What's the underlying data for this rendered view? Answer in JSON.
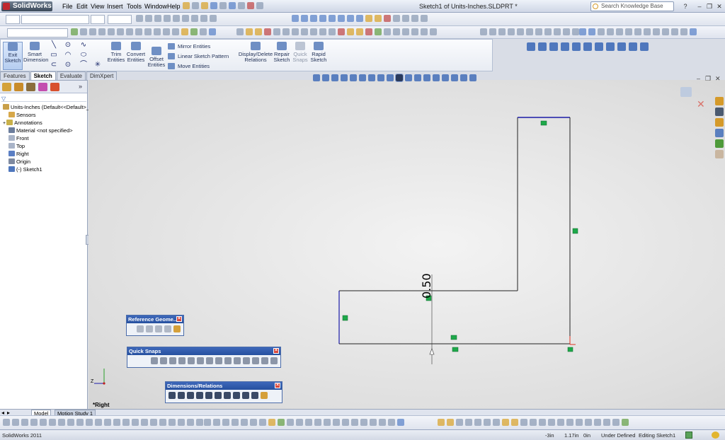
{
  "app": {
    "name": "SolidWorks",
    "document_title": "Sketch1 of Units-Inches.SLDPRT *"
  },
  "menu": [
    "File",
    "Edit",
    "View",
    "Insert",
    "Tools",
    "Window",
    "Help"
  ],
  "search": {
    "placeholder": "Search Knowledge Base"
  },
  "command_manager": {
    "exit_sketch": "Exit Sketch",
    "smart_dimension": "Smart Dimension",
    "trim_entities": "Trim Entities",
    "convert_entities": "Convert Entities",
    "offset_entities": "Offset Entities",
    "mirror_entities": "Mirror Entities",
    "linear_sketch_pattern": "Linear Sketch Pattern",
    "move_entities": "Move Entities",
    "display_delete_relations": "Display/Delete Relations",
    "repair_sketch": "Repair Sketch",
    "quick_snaps": "Quick Snaps",
    "rapid_sketch": "Rapid Sketch"
  },
  "tabs": [
    {
      "label": "Features",
      "active": false
    },
    {
      "label": "Sketch",
      "active": true
    },
    {
      "label": "Evaluate",
      "active": false
    },
    {
      "label": "DimXpert",
      "active": false
    }
  ],
  "tree": {
    "root": "Units-Inches  (Default<<Default>_F",
    "items": [
      "Sensors",
      "Annotations",
      "Material <not specified>",
      "Front",
      "Top",
      "Right",
      "Origin",
      "(-) Sketch1"
    ]
  },
  "sketch": {
    "dimension": "0.50",
    "view_label": "*Right",
    "triad_z": "Z",
    "line_color": "#222222",
    "selected_color": "#1a1aa8",
    "relation_color": "#1ea84a"
  },
  "floating_toolbars": {
    "reference_geometry": "Reference Geome...",
    "quick_snaps": "Quick Snaps",
    "dimensions_relations": "Dimensions/Relations"
  },
  "bottom_tabs": [
    "Model",
    "Motion Study 1"
  ],
  "status": {
    "app": "SolidWorks 2011",
    "x": "-3in",
    "y": "1.17in",
    "z": "0in",
    "state": "Under Defined",
    "mode": "Editing Sketch1"
  }
}
